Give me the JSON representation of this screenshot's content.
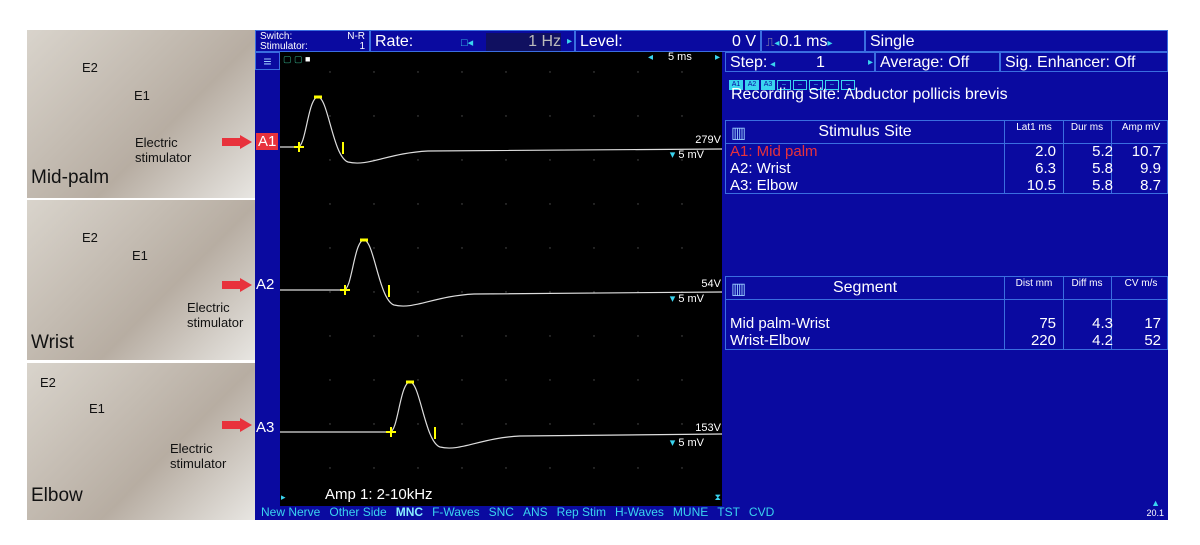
{
  "photos": [
    {
      "site": "Mid-palm",
      "e2": "E2",
      "e1": "E1",
      "device": "Electric stimulator"
    },
    {
      "site": "Wrist",
      "e2": "E2",
      "e1": "E1",
      "device": "Electric stimulator"
    },
    {
      "site": "Elbow",
      "e2": "E2",
      "e1": "E1",
      "device": "Electric stimulator"
    }
  ],
  "toolbar": {
    "switch_label": "Switch:",
    "switch_value": "N-R",
    "stimulator_label": "Stimulator:",
    "stimulator_value": "1",
    "rate_label": "Rate:",
    "rate_value": "1 Hz",
    "level_label": "Level:",
    "level_value": "0 V",
    "duration": "0.1 ms",
    "mode": "Single",
    "step_label": "Step:",
    "step_value": "1",
    "average": "Average: Off",
    "enhancer": "Sig. Enhancer: Off"
  },
  "trace": {
    "timebase": "5 ms",
    "amp_filter": "Amp 1: 2-10kHz",
    "channels": [
      {
        "label": "A1",
        "level": "279V",
        "sens": "5 mV"
      },
      {
        "label": "A2",
        "level": "54V",
        "sens": "5 mV"
      },
      {
        "label": "A3",
        "level": "153V",
        "sens": "5 mV"
      }
    ]
  },
  "chips": [
    "A1",
    "A2",
    "A3",
    "–",
    "–",
    "–",
    "–",
    "–"
  ],
  "recording_site": "Recording Site: Abductor pollicis brevis",
  "stim_table": {
    "headers": [
      "Stimulus Site",
      "Lat1 ms",
      "Dur ms",
      "Amp mV"
    ],
    "rows": [
      [
        "A1: Mid palm",
        "2.0",
        "5.2",
        "10.7"
      ],
      [
        "A2: Wrist",
        "6.3",
        "5.8",
        "9.9"
      ],
      [
        "A3: Elbow",
        "10.5",
        "5.8",
        "8.7"
      ]
    ]
  },
  "seg_table": {
    "headers": [
      "Segment",
      "Dist mm",
      "Diff ms",
      "CV m/s"
    ],
    "rows": [
      [
        "Mid palm-Wrist",
        "75",
        "4.3",
        "17"
      ],
      [
        "Wrist-Elbow",
        "220",
        "4.2",
        "52"
      ]
    ]
  },
  "menu": [
    "New Nerve",
    "Other Side",
    "MNC",
    "F-Waves",
    "SNC",
    "ANS",
    "Rep Stim",
    "H-Waves",
    "MUNE",
    "TST",
    "CVD"
  ],
  "version": "20.1",
  "colors": {
    "screen": "#0a0aa0",
    "cyan": "#3ad4ef",
    "highlight": "#e8323c"
  }
}
